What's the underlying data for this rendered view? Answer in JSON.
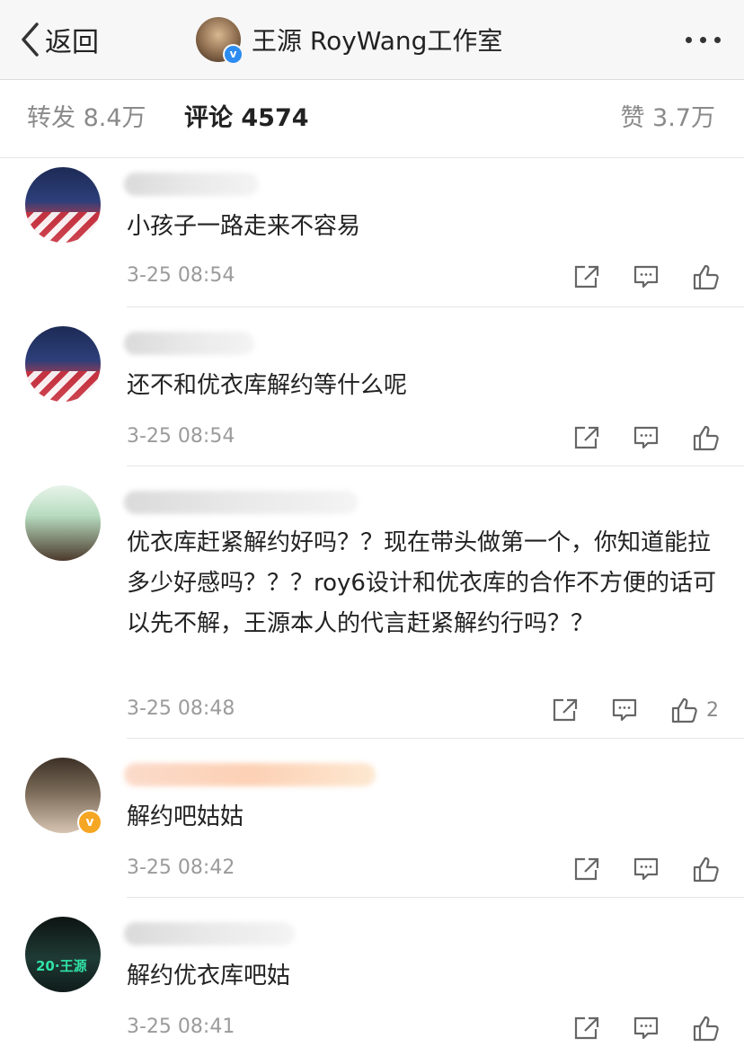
{
  "nav": {
    "back_label": "返回",
    "title": "王源 RoyWang工作室",
    "verify_mark": "v",
    "more_icon": "more-dots-icon"
  },
  "tabs": {
    "repost": "转发 8.4万",
    "comments": "评论 4574",
    "likes": "赞 3.7万"
  },
  "comments": [
    {
      "text": "小孩子一路走来不容易",
      "time": "3-25 08:54",
      "likes": ""
    },
    {
      "text": "还不和优衣库解约等什么呢",
      "time": "3-25 08:54",
      "likes": ""
    },
    {
      "text": "优衣库赶紧解约好吗？？现在带头做第一个，你知道能拉多少好感吗？？？roy6设计和优衣库的合作不方便的话可以先不解，王源本人的代言赶紧解约行吗？？",
      "time": "3-25 08:48",
      "likes": "2"
    },
    {
      "text": "解约吧姑姑",
      "time": "3-25 08:42",
      "likes": ""
    },
    {
      "text": "解约优衣库吧姑",
      "time": "3-25 08:41",
      "likes": ""
    }
  ],
  "avatar_badges": {
    "gold_verify": "v",
    "avatar5_text": "20·王源"
  },
  "colors": {
    "nav_bg": "#f7f7f7",
    "verify_blue": "#2d8cf0",
    "verify_gold": "#f5a623",
    "muted_text": "#9b9b9b"
  }
}
